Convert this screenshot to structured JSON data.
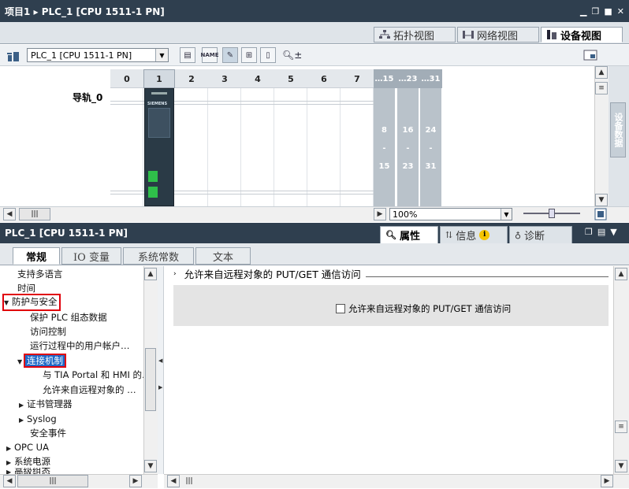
{
  "title_bar": {
    "text": "项目1 ▸ PLC_1 [CPU 1511-1 PN]"
  },
  "view_tabs": {
    "topology": "拓扑视图",
    "network": "网络视图",
    "device": "设备视图"
  },
  "toolbar": {
    "device_select": "PLC_1 [CPU 1511-1 PN]"
  },
  "rack": {
    "rail_label": "导轨_0",
    "slots": [
      "0",
      "1",
      "2",
      "3",
      "4",
      "5",
      "6",
      "7"
    ],
    "expansion_headers": [
      "…15",
      "…23",
      "…31"
    ],
    "expansion_top": [
      "8",
      "16",
      "24"
    ],
    "expansion_dash": [
      "-",
      "-",
      "-"
    ],
    "expansion_bottom": [
      "15",
      "23",
      "31"
    ],
    "cpu_brand": "SIEMENS",
    "side_tab": "设备数据"
  },
  "zoom": {
    "value": "100%"
  },
  "inspector": {
    "title": "PLC_1 [CPU 1511-1 PN]",
    "tabs": {
      "properties": "属性",
      "info": "信息",
      "diagnostics": "诊断"
    }
  },
  "prop_tabs": [
    "常规",
    "IO 变量",
    "系统常数",
    "文本"
  ],
  "tree": {
    "multilang": "支持多语言",
    "time": "时间",
    "protection": "防护与安全",
    "protect_plc": "保护 PLC 组态数据",
    "access": "访问控制",
    "runtime_users": "运行过程中的用户帐户…",
    "connection": "连接机制",
    "tia_hmi": "与 TIA Portal 和 HMI 的…",
    "putget_short": "允许来自远程对象的 …",
    "cert": "证书管理器",
    "syslog": "Syslog",
    "security_events": "安全事件",
    "opcua": "OPC UA",
    "system_power": "系统电源",
    "cut_off": "高级组态"
  },
  "content": {
    "section_title": "允许来自远程对象的 PUT/GET 通信访问",
    "checkbox_label": "允许来自远程对象的 PUT/GET 通信访问",
    "checkbox_checked": false
  }
}
